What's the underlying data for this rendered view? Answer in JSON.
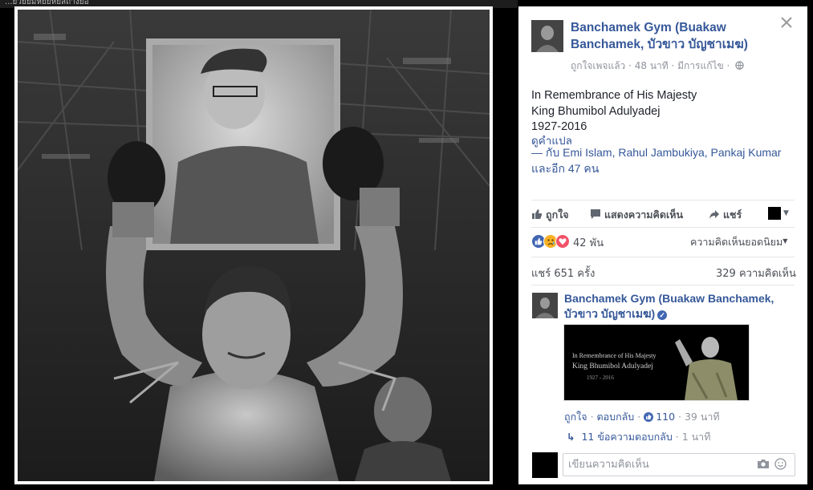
{
  "top_strip_text": "...ยวยยมีหยยหยสถ่างยอ",
  "post": {
    "page_name": "Banchamek Gym (Buakaw Banchamek, บัวขาว บัญชาเมฆ)",
    "meta": "ถูกใจเพจแล้ว · 48 นาที · มีการแก้ไข ·",
    "text_lines": [
      "In Remembrance of His Majesty",
      "King Bhumibol Adulyadej",
      "1927-2016"
    ],
    "see_translation": "ดูคำแปล",
    "tagged": "— กับ Emi Islam, Rahul Jambukiya, Pankaj Kumar และอีก 47 คน"
  },
  "actions": {
    "like": "ถูกใจ",
    "comment": "แสดงความคิดเห็น",
    "share": "แชร์"
  },
  "reactions": {
    "count": "42 พัน",
    "top_comments": "ความคิดเห็นยอดนิยม",
    "colors": {
      "like": "#4267b2",
      "sad": "#f7b125",
      "love": "#f25268"
    }
  },
  "stats": {
    "shares": "แชร์ 651 ครั้ง",
    "comments": "329 ความคิดเห็น"
  },
  "comment": {
    "author": "Banchamek Gym (Buakaw Banchamek, บัวขาว บัญชาเมฆ)",
    "image_text": [
      "In Remembrance of His Majesty",
      "King Bhumibol Adulyadej",
      "1927 - 2016"
    ],
    "like": "ถูกใจ",
    "reply": "ตอบกลับ",
    "like_count": "110",
    "time": "39 นาที",
    "replies": "11 ข้อความตอบกลับ",
    "replies_time": "1 นาที"
  },
  "input": {
    "placeholder": "เขียนความคิดเห็น"
  }
}
